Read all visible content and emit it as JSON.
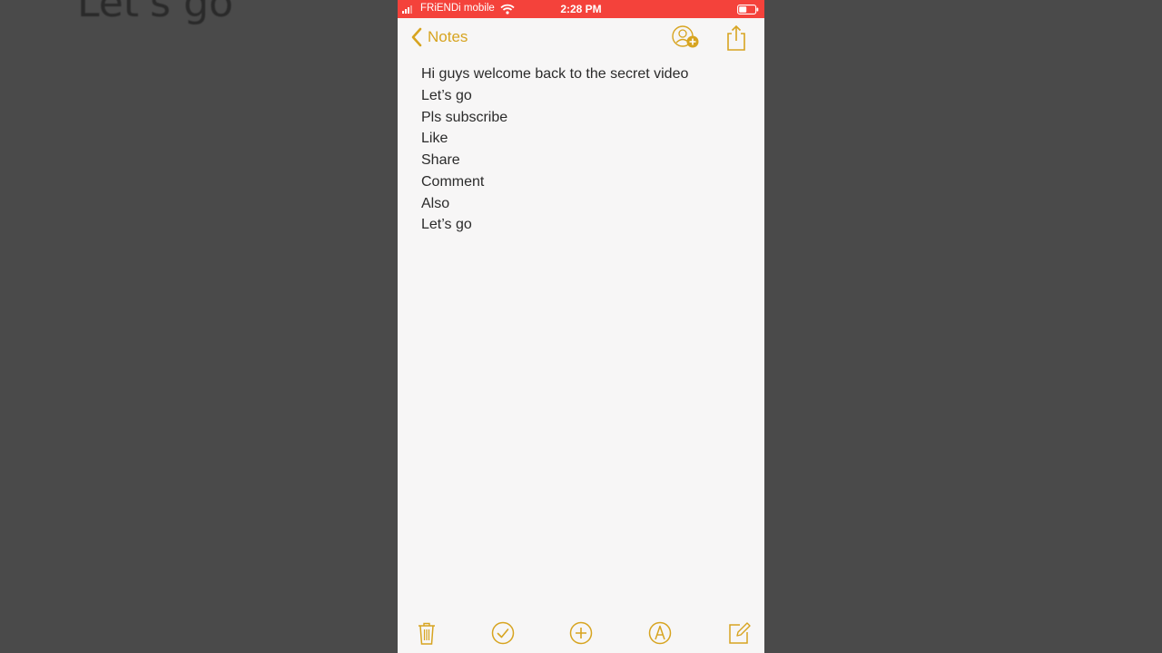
{
  "background": {
    "ghost_text": "Let's go"
  },
  "status_bar": {
    "carrier": "FRiENDi mobile",
    "time": "2:28 PM",
    "background_color": "#f4423b"
  },
  "nav": {
    "back_label": "Notes",
    "accent_color": "#d7a420",
    "icons": [
      "back-chevron-icon",
      "add-person-icon",
      "share-icon"
    ]
  },
  "note": {
    "lines": [
      "Hi guys welcome back to the secret video",
      "Let’s go",
      "Pls subscribe",
      "Like",
      "Share",
      "Comment",
      "Also",
      "Let’s go"
    ]
  },
  "toolbar": {
    "icons": [
      "trash-icon",
      "checklist-icon",
      "add-icon",
      "markup-icon",
      "compose-icon"
    ]
  }
}
